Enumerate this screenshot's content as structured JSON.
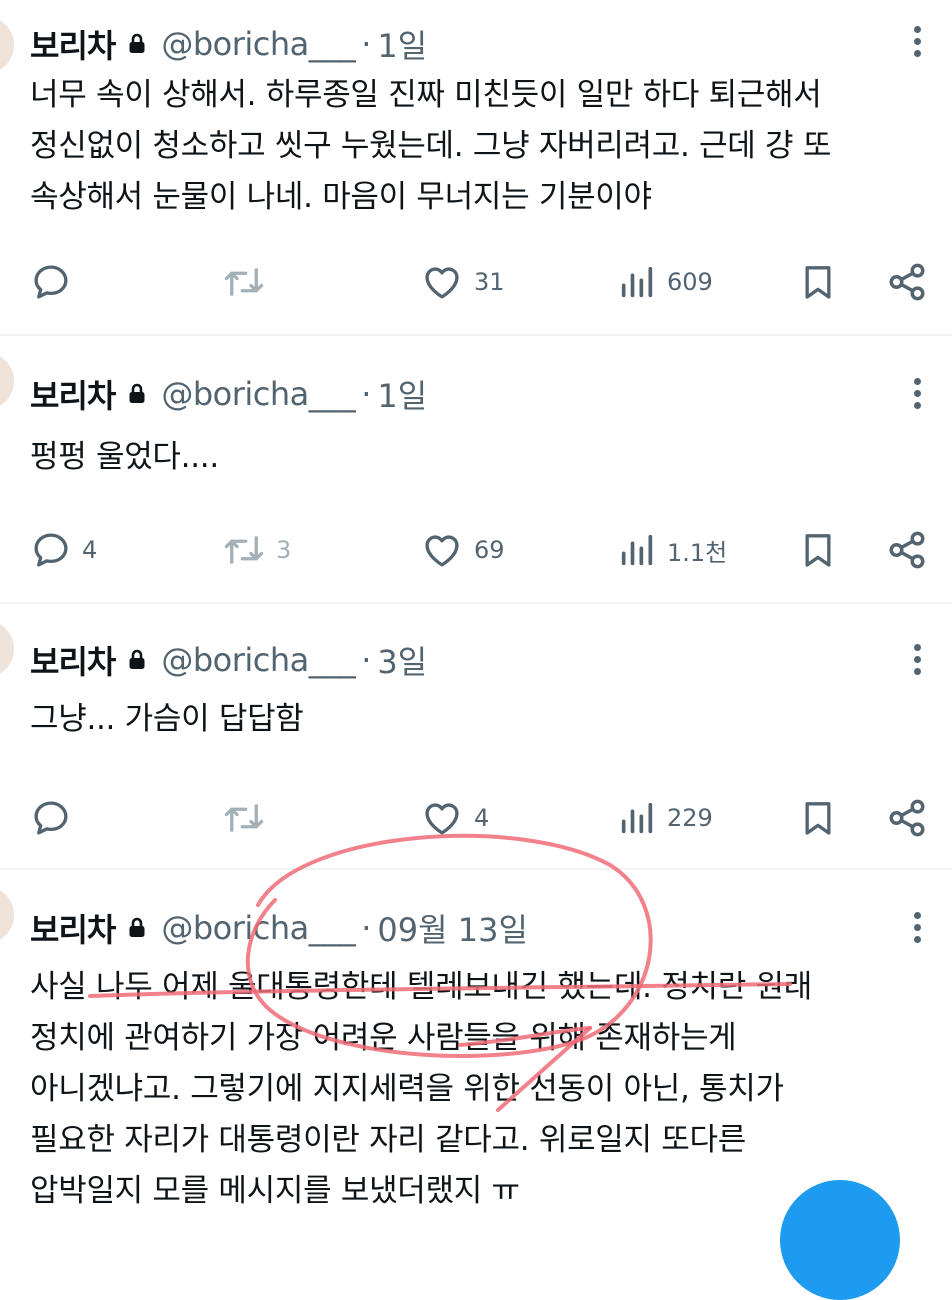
{
  "tweets": [
    {
      "name": "보리차",
      "handle": "@boricha___",
      "sep": "·",
      "time": "1일",
      "text": "너무 속이 상해서. 하루종일 진짜 미친듯이 일만 하다 퇴근해서\n정신없이 청소하고 씻구 누웠는데. 그냥 자버리려고. 근데 걍 또\n속상해서 눈물이 나네. 마음이 무너지는 기분이야",
      "replies": "",
      "retweets": "",
      "likes": "31",
      "views": "609"
    },
    {
      "name": "보리차",
      "handle": "@boricha___",
      "sep": "·",
      "time": "1일",
      "text": "펑펑 울었다....",
      "replies": "4",
      "retweets": "3",
      "likes": "69",
      "views": "1.1천"
    },
    {
      "name": "보리차",
      "handle": "@boricha___",
      "sep": "·",
      "time": "3일",
      "text": "그냥... 가슴이 답답함",
      "replies": "",
      "retweets": "",
      "likes": "4",
      "views": "229"
    },
    {
      "name": "보리차",
      "handle": "@boricha___",
      "sep": "·",
      "time": "09월 13일",
      "text": "사실 나두 어제 울대통령한테 텔레보내긴 했는데. 정치란 원래\n정치에 관여하기 가장 어려운 사람들을 위해 존재하는게\n아니겠냐고. 그렇기에 지지세력을 위한 선동이 아닌, 통치가\n필요한 자리가 대통령이란 자리 같다고. 위로일지 또다른\n압박일지 모를 메시지를 보냈더랬지 ㅠ"
    }
  ],
  "icons": {
    "lock": "lock-icon",
    "more": "more-icon",
    "reply": "reply-icon",
    "retweet": "retweet-icon",
    "like": "heart-icon",
    "views": "views-icon",
    "bookmark": "bookmark-icon",
    "share": "share-icon"
  },
  "colors": {
    "text": "#0f1419",
    "secondary": "#536471",
    "divider": "#eff3f4",
    "annotation": "#ee6b75",
    "accent": "#1d9bf0"
  }
}
